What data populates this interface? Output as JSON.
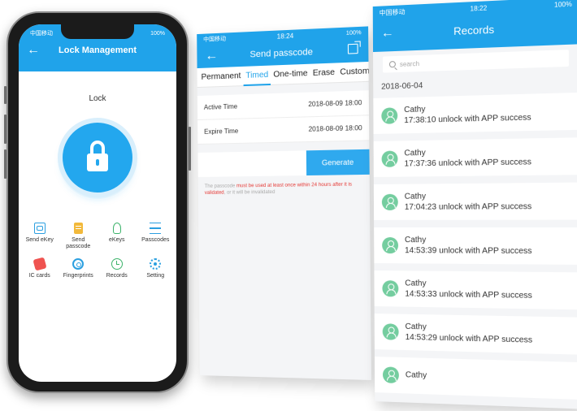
{
  "phone": {
    "status_carrier": "中国移动",
    "status_battery": "100%",
    "title": "Lock Management",
    "lock_label": "Lock",
    "grid": [
      {
        "label": "Send eKey",
        "icon": "send-ekey-icon"
      },
      {
        "label": "Send passcode",
        "icon": "send-passcode-icon"
      },
      {
        "label": "eKeys",
        "icon": "ekeys-icon"
      },
      {
        "label": "Passcodes",
        "icon": "passcodes-icon"
      },
      {
        "label": "IC cards",
        "icon": "ic-cards-icon"
      },
      {
        "label": "Fingerprints",
        "icon": "fingerprints-icon"
      },
      {
        "label": "Records",
        "icon": "records-icon"
      },
      {
        "label": "Setting",
        "icon": "setting-icon"
      }
    ]
  },
  "passcode_screen": {
    "status_carrier": "中国移动",
    "status_time": "18:24",
    "status_battery": "100%",
    "title": "Send passcode",
    "tabs": [
      "Permanent",
      "Timed",
      "One-time",
      "Erase",
      "Custom"
    ],
    "active_tab": "Timed",
    "active_time_label": "Active Time",
    "active_time_value": "2018-08-09 18:00",
    "expire_time_label": "Expire Time",
    "expire_time_value": "2018-08-09 18:00",
    "generate_label": "Generate",
    "notice_prefix": "The passcode ",
    "notice_red": "must be used at least once within 24 hours after it is validated",
    "notice_suffix": ", or it will be invalidated"
  },
  "records_screen": {
    "status_carrier": "中国移动",
    "status_time": "18:22",
    "status_battery": "100%",
    "title": "Records",
    "search_placeholder": "search",
    "date": "2018-06-04",
    "records": [
      {
        "name": "Cathy",
        "line": "17:38:10 unlock with APP success"
      },
      {
        "name": "Cathy",
        "line": "17:37:36 unlock with APP success"
      },
      {
        "name": "Cathy",
        "line": "17:04:23 unlock with APP success"
      },
      {
        "name": "Cathy",
        "line": "14:53:39 unlock with APP success"
      },
      {
        "name": "Cathy",
        "line": "14:53:33 unlock with APP success"
      },
      {
        "name": "Cathy",
        "line": "14:53:29 unlock with APP success"
      },
      {
        "name": "Cathy",
        "line": ""
      }
    ]
  }
}
